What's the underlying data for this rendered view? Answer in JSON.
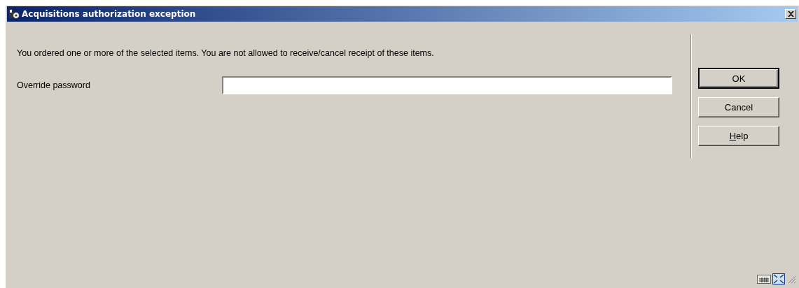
{
  "window": {
    "title": "Acquisitions authorization exception"
  },
  "message": "You ordered one or more of the selected items. You are not allowed to receive/cancel receipt of these items.",
  "fields": [
    {
      "label": "Override password"
    }
  ],
  "buttons": [
    {
      "label": "OK",
      "default": true
    },
    {
      "label": "Cancel",
      "default": false
    },
    {
      "label": "Help",
      "default": false,
      "mnemonic_underlined": true
    }
  ]
}
